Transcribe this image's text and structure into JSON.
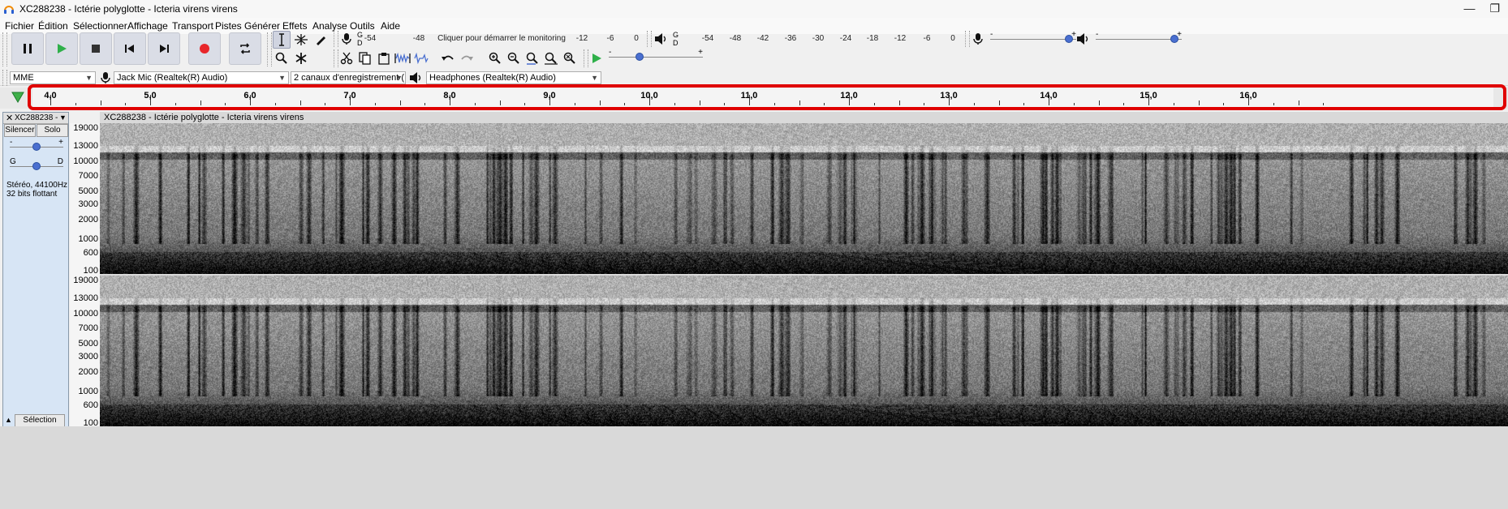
{
  "window": {
    "title": "XC288238 - Ictérie polyglotte - Icteria virens virens",
    "buttons": {
      "minimize": "—",
      "restore": "❐"
    }
  },
  "menu": [
    "Fichier",
    "Édition",
    "Sélectionner",
    "Affichage",
    "Transport",
    "Pistes",
    "Générer",
    "Effets",
    "Analyse",
    "Outils",
    "Aide"
  ],
  "recording_meter": {
    "left_letter": "G",
    "right_letter": "D",
    "monitor_prompt": "Cliquer pour démarrer le monitoring",
    "scale_left": [
      "-54",
      "-48"
    ],
    "scale_right": [
      "-12",
      "-6",
      "0"
    ]
  },
  "playback_meter": {
    "left_letter": "G",
    "right_letter": "D",
    "scale": [
      "-54",
      "-48",
      "-42",
      "-36",
      "-30",
      "-24",
      "-18",
      "-12",
      "-6",
      "0"
    ]
  },
  "mixer": {
    "recording_volume": 1.0,
    "playback_volume": 1.0,
    "minus": "-",
    "plus": "+"
  },
  "play_at_speed": {
    "speed": 0.3
  },
  "devices": {
    "host": "MME",
    "recording_device": "Jack Mic (Realtek(R) Audio)",
    "channels": "2 canaux d'enregistrement (",
    "playback_device": "Headphones (Realtek(R) Audio)"
  },
  "ruler": {
    "labels": [
      "4,0",
      "5,0",
      "6,0",
      "7,0",
      "8,0",
      "9,0",
      "10,0",
      "11,0",
      "12,0",
      "13,0",
      "14,0",
      "15,0",
      "16,0"
    ]
  },
  "track": {
    "name": "XC288238 -",
    "mute": "Silencer",
    "solo": "Solo",
    "gain_minus": "-",
    "gain_plus": "+",
    "pan_left": "G",
    "pan_right": "D",
    "gain": 0.5,
    "pan": 0.5,
    "info_line1": "Stéréo, 44100Hz",
    "info_line2": "32 bits flottant",
    "select_button": "Sélection",
    "clip_title": "XC288238 - Ictérie polyglotte - Icteria virens virens"
  },
  "frequency_axis": [
    "19000",
    "13000",
    "10000",
    "7000",
    "5000",
    "3000",
    "2000",
    "1000",
    "600",
    "100"
  ],
  "colors": {
    "highlight": "#e00000",
    "record": "#e8262a",
    "play": "#2fb04a",
    "accent": "#4a6fd0"
  }
}
